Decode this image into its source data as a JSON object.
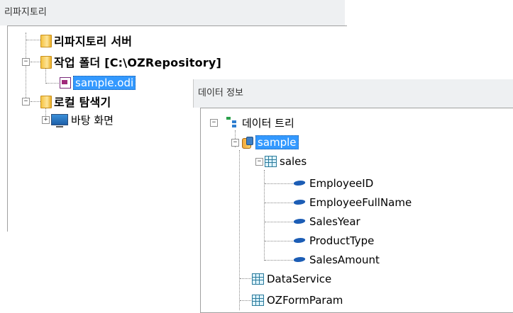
{
  "repo_panel": {
    "title": "리파지토리",
    "items": [
      {
        "label": "리파지토리 서버"
      },
      {
        "label": "작업 폴더 [C:\\OZRepository]"
      },
      {
        "label": "sample.odi"
      },
      {
        "label": "로컬 탐색기"
      },
      {
        "label": "바탕 화면"
      }
    ]
  },
  "data_panel": {
    "title": "데이터 정보",
    "root": "데이터 트리",
    "source": "sample",
    "table": "sales",
    "fields": [
      "EmployeeID",
      "EmployeeFullName",
      "SalesYear",
      "ProductType",
      "SalesAmount"
    ],
    "others": [
      "DataService",
      "OZFormParam"
    ]
  },
  "expanders": {
    "collapsed": "+",
    "expanded": "−"
  }
}
